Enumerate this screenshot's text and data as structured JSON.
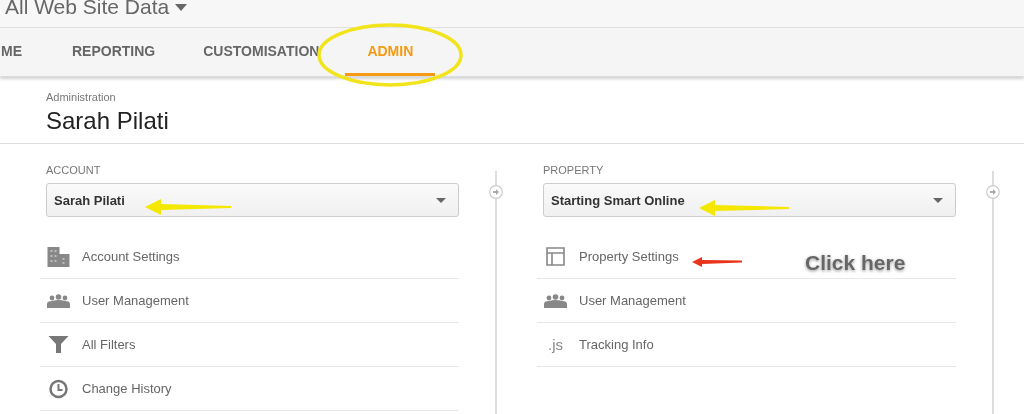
{
  "view_selector": {
    "label": "All Web Site Data"
  },
  "tabs": [
    {
      "label": "ME",
      "selected": false
    },
    {
      "label": "REPORTING",
      "selected": false
    },
    {
      "label": "CUSTOMISATION",
      "selected": false
    },
    {
      "label": "ADMIN",
      "selected": true
    }
  ],
  "header": {
    "caption": "Administration",
    "title": "Sarah Pilati"
  },
  "columns": [
    {
      "heading": "ACCOUNT",
      "dropdown": "Sarah Pilati",
      "items": [
        {
          "label": "Account Settings",
          "kind": "building"
        },
        {
          "label": "User Management",
          "kind": "people"
        },
        {
          "label": "All Filters",
          "kind": "filter"
        },
        {
          "label": "Change History",
          "kind": "history"
        }
      ]
    },
    {
      "heading": "PROPERTY",
      "dropdown": "Starting Smart Online",
      "items": [
        {
          "label": "Property Settings",
          "kind": "layout"
        },
        {
          "label": "User Management",
          "kind": "people"
        },
        {
          "label": "Tracking Info",
          "kind": "js",
          "icon_text": ".js"
        }
      ]
    }
  ],
  "annotation": {
    "text": "Click here"
  }
}
